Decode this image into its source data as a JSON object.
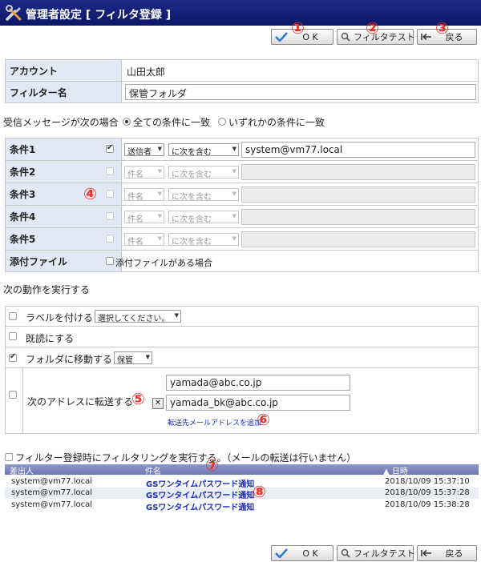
{
  "header": {
    "title": "管理者設定 [ フィルタ登録 ]"
  },
  "toolbar": {
    "ok_label": "O K",
    "test_label": "フィルタテスト",
    "back_label": "戻る"
  },
  "markers": [
    "①",
    "②",
    "③",
    "④",
    "⑤",
    "⑥",
    "⑦",
    "⑧"
  ],
  "account": {
    "label": "アカウント",
    "value": "山田太郎"
  },
  "filter_name": {
    "label": "フィルター名",
    "value": "保管フォルダ"
  },
  "match": {
    "label": "受信メッセージが次の場合",
    "all": "全ての条件に一致",
    "any": "いずれかの条件に一致",
    "selected": "all"
  },
  "conditions": [
    {
      "label": "条件1",
      "checked": true,
      "field": "送信者",
      "op": "に次を含む",
      "value": "system@vm77.local",
      "enabled": true
    },
    {
      "label": "条件2",
      "checked": false,
      "field": "件名",
      "op": "に次を含む",
      "value": "",
      "enabled": false
    },
    {
      "label": "条件3",
      "checked": false,
      "field": "件名",
      "op": "に次を含む",
      "value": "",
      "enabled": false
    },
    {
      "label": "条件4",
      "checked": false,
      "field": "件名",
      "op": "に次を含む",
      "value": "",
      "enabled": false
    },
    {
      "label": "条件5",
      "checked": false,
      "field": "件名",
      "op": "に次を含む",
      "value": "",
      "enabled": false
    }
  ],
  "attachment": {
    "label": "添付ファイル",
    "option": "添付ファイルがある場合"
  },
  "actions": {
    "heading": "次の動作を実行する",
    "label_action": {
      "text": "ラベルを付ける",
      "select": "選択してください。"
    },
    "mark_read": {
      "text": "既読にする"
    },
    "move": {
      "text": "フォルダに移動する",
      "select": "保管"
    },
    "forward": {
      "text": "次のアドレスに転送する",
      "addresses": [
        "yamada@abc.co.jp",
        "yamada_bk@abc.co.jp"
      ],
      "add_link": "転送先メールアドレスを追加"
    }
  },
  "run_filter": {
    "text": "フィルター登録時にフィルタリングを実行する。（メールの転送は行いません）"
  },
  "list": {
    "headers": {
      "sender": "差出人",
      "subject": "件名",
      "date": "▲ 日時"
    },
    "rows": [
      {
        "sender": "system@vm77.local",
        "subject": "GSワンタイムパスワード通知",
        "date": "2018/10/09 15:37:10"
      },
      {
        "sender": "system@vm77.local",
        "subject": "GSワンタイムパスワード通知",
        "date": "2018/10/09 15:37:28"
      },
      {
        "sender": "system@vm77.local",
        "subject": "GSワンタイムパスワード通知",
        "date": "2018/10/09 15:38:28"
      }
    ]
  },
  "colors": {
    "header_bg": "#0d1768",
    "label_bg": "#e3e8f6",
    "marker": "#e8332a",
    "link": "#1a2db5"
  }
}
